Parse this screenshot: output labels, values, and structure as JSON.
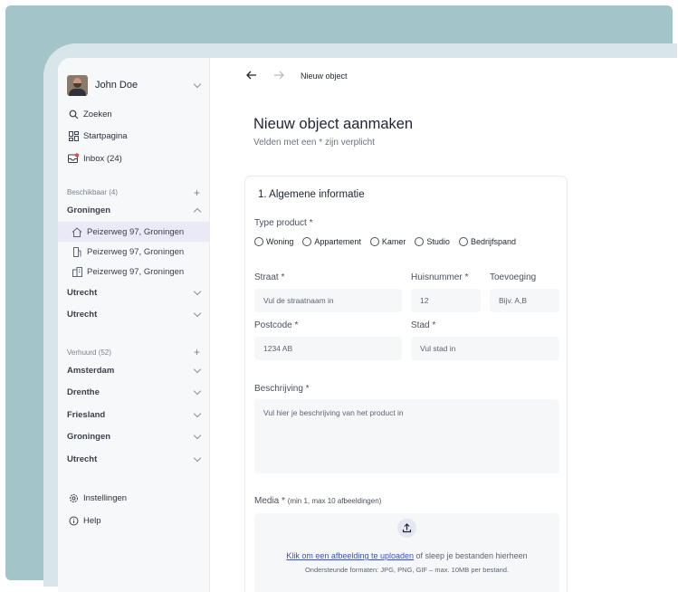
{
  "user": {
    "name": "John Doe"
  },
  "nav": [
    {
      "label": "Zoeken",
      "icon": "search-icon"
    },
    {
      "label": "Startpagina",
      "icon": "grid-icon"
    },
    {
      "label": "Inbox (24)",
      "icon": "inbox-icon"
    }
  ],
  "available": {
    "heading": "Beschikbaar (4)",
    "groups": [
      {
        "label": "Groningen",
        "open": true,
        "items": [
          {
            "label": "Peizerweg 97, Groningen",
            "icon": "house-icon",
            "active": true
          },
          {
            "label": "Peizerweg 97, Groningen",
            "icon": "building-icon"
          },
          {
            "label": "Peizerweg 97, Groningen",
            "icon": "apartment-icon"
          }
        ]
      },
      {
        "label": "Utrecht"
      },
      {
        "label": "Utrecht"
      }
    ]
  },
  "rented": {
    "heading": "Verhuurd (52)",
    "groups": [
      "Amsterdam",
      "Drenthe",
      "Friesland",
      "Groningen",
      "Utrecht"
    ]
  },
  "footer_nav": [
    {
      "label": "Instellingen",
      "icon": "gear-icon"
    },
    {
      "label": "Help",
      "icon": "info-icon"
    }
  ],
  "breadcrumb": {
    "current": "Nieuw object"
  },
  "page": {
    "title": "Nieuw object aanmaken",
    "subtitle": "Velden met een * zijn verplicht"
  },
  "form": {
    "section_title": "1. Algemene informatie",
    "type_label": "Type product *",
    "types": [
      "Woning",
      "Appartement",
      "Kamer",
      "Studio",
      "Bedrijfspand"
    ],
    "street_label": "Straat *",
    "street_placeholder": "Vul de straatnaam in",
    "number_label": "Huisnummer *",
    "number_placeholder": "12",
    "addition_label": "Toevoeging",
    "addition_placeholder": "Bijv. A,B",
    "postcode_label": "Postcode *",
    "postcode_placeholder": "1234 AB",
    "city_label": "Stad *",
    "city_placeholder": "Vul stad in",
    "description_label": "Beschrijving *",
    "description_placeholder": "Vul hier je beschrijving van het product in",
    "media_label": "Media *",
    "media_hint": "(min 1, max 10 afbeeldingen)",
    "upload_link": "Klik om een afbeelding te uploaden",
    "upload_text": " of sleep je bestanden hierheen",
    "upload_formats": "Ondersteunde formaten: JPG, PNG, GIF – max. 10MB per bestand."
  },
  "colors": {
    "accent": "#3453c7",
    "background": "#a3c5c9",
    "active_item": "#e9eaf6"
  }
}
